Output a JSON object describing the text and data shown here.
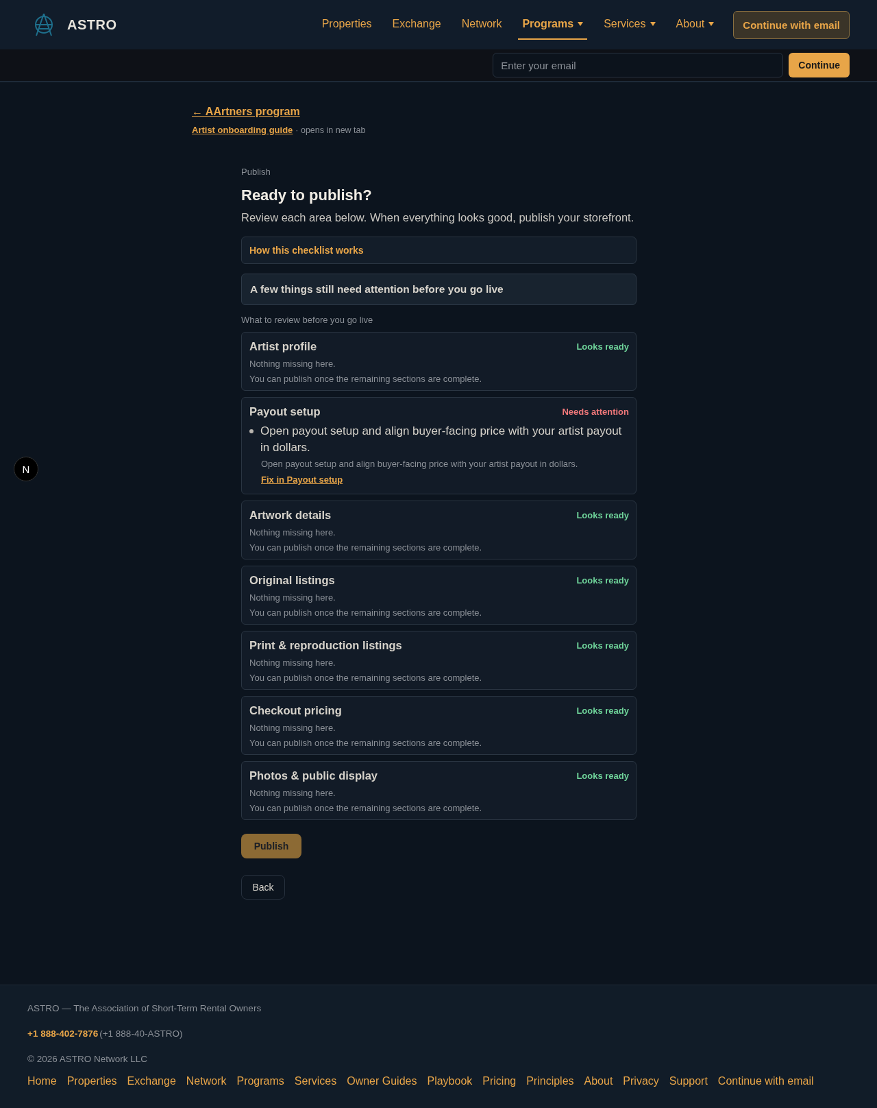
{
  "header": {
    "brand": "ASTRO",
    "nav": [
      {
        "label": "Properties",
        "selected": false,
        "has_menu": false
      },
      {
        "label": "Exchange",
        "selected": false,
        "has_menu": false
      },
      {
        "label": "Network",
        "selected": false,
        "has_menu": false
      },
      {
        "label": "Programs",
        "selected": true,
        "has_menu": true
      },
      {
        "label": "Services",
        "selected": false,
        "has_menu": true
      },
      {
        "label": "About",
        "selected": false,
        "has_menu": true
      }
    ],
    "cta": "Continue with email"
  },
  "email_bar": {
    "placeholder": "Enter your email",
    "button": "Continue"
  },
  "back_link": "← AArtners program",
  "guide": {
    "link": "Artist onboarding guide",
    "note": "· opens in new tab"
  },
  "eyebrow": "Publish",
  "title": "Ready to publish?",
  "subtitle": "Review each area below. When everything looks good, publish your storefront.",
  "how_it_works": "How this checklist works",
  "alert": "A few things still need attention before you go live",
  "list_label": "What to review before you go live",
  "sections": [
    {
      "title": "Artist profile",
      "kind": "ready",
      "status": "Looks ready",
      "lines": [
        "Nothing missing here.",
        "You can publish once the remaining sections are complete."
      ]
    },
    {
      "title": "Payout setup",
      "kind": "attention",
      "status": "Needs attention",
      "issue": "Open payout setup and align buyer-facing price with your artist payout in dollars.",
      "detail": "Open payout setup and align buyer-facing price with your artist payout in dollars.",
      "fix": "Fix in Payout setup"
    },
    {
      "title": "Artwork details",
      "kind": "ready",
      "status": "Looks ready",
      "lines": [
        "Nothing missing here.",
        "You can publish once the remaining sections are complete."
      ]
    },
    {
      "title": "Original listings",
      "kind": "ready",
      "status": "Looks ready",
      "lines": [
        "Nothing missing here.",
        "You can publish once the remaining sections are complete."
      ]
    },
    {
      "title": "Print & reproduction listings",
      "kind": "ready",
      "status": "Looks ready",
      "lines": [
        "Nothing missing here.",
        "You can publish once the remaining sections are complete."
      ]
    },
    {
      "title": "Checkout pricing",
      "kind": "ready",
      "status": "Looks ready",
      "lines": [
        "Nothing missing here.",
        "You can publish once the remaining sections are complete."
      ]
    },
    {
      "title": "Photos & public display",
      "kind": "ready",
      "status": "Looks ready",
      "lines": [
        "Nothing missing here.",
        "You can publish once the remaining sections are complete."
      ]
    }
  ],
  "publish_button": {
    "label": "Publish",
    "disabled": true
  },
  "back_button": "Back",
  "dev_badge": "N",
  "footer": {
    "tagline": "ASTRO — The Association of Short-Term Rental Owners",
    "phone": "+1 888-402-7876",
    "phone_alt": "(+1 888-40-ASTRO)",
    "copyright": "© 2026 ASTRO Network LLC",
    "links": [
      "Home",
      "Properties",
      "Exchange",
      "Network",
      "Programs",
      "Services",
      "Owner Guides",
      "Playbook",
      "Pricing",
      "Principles",
      "About",
      "Privacy",
      "Support",
      "Continue with email"
    ]
  }
}
